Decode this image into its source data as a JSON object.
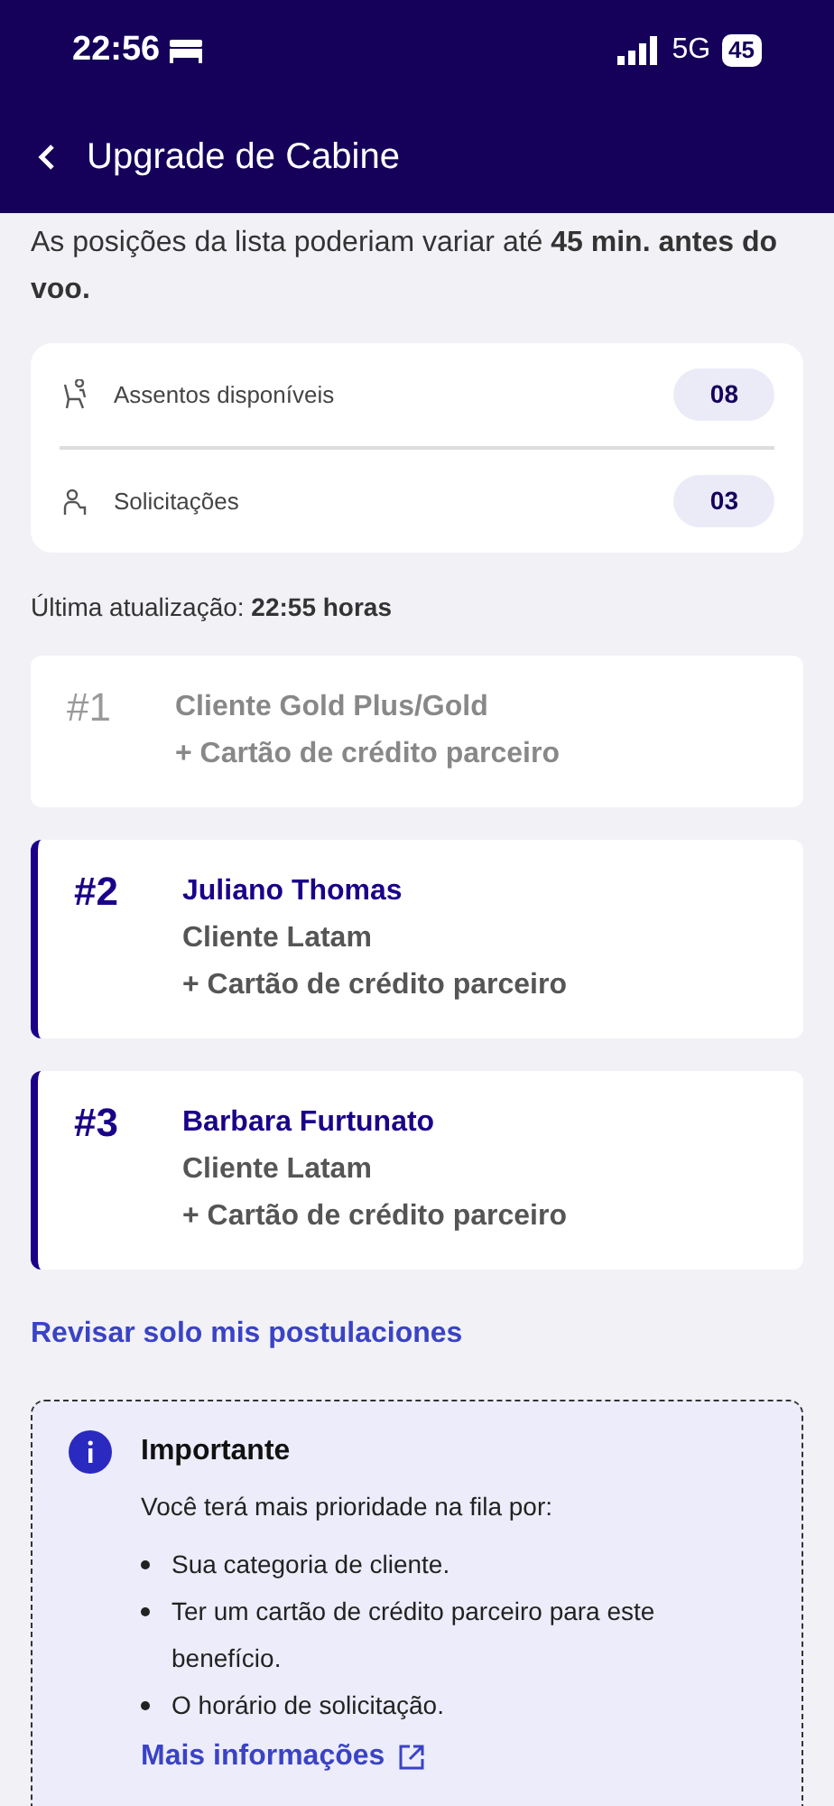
{
  "status_bar": {
    "time": "22:56",
    "network": "5G",
    "battery": "45"
  },
  "header": {
    "title": "Upgrade de Cabine"
  },
  "notice": "As posições da lista poderiam variar até **45 min. antes do voo.**",
  "summary": [
    {
      "kind": "seat",
      "label": "Assentos disponíveis",
      "count": "08"
    },
    {
      "kind": "person",
      "label": "Solicitações",
      "count": "03"
    }
  ],
  "last_update": "Última atualização: **22:55 horas**",
  "queue": [
    {
      "position": "#1",
      "highlighted": false,
      "lines": [
        "Cliente Gold Plus/Gold",
        "+ Cartão de crédito parceiro"
      ]
    },
    {
      "position": "#2",
      "highlighted": true,
      "name": "Juliano Thomas",
      "lines": [
        "Cliente Latam",
        "+ Cartão de crédito parceiro"
      ]
    },
    {
      "position": "#3",
      "highlighted": true,
      "name": "Barbara Furtunato",
      "lines": [
        "Cliente Latam",
        "+ Cartão de crédito parceiro"
      ]
    }
  ],
  "review_link": "Revisar solo mis postulaciones",
  "info": {
    "title": "Importante",
    "intro": "Você terá mais prioridade na fila por:",
    "bullets": [
      "Sua categoria de cliente.",
      "Ter um cartão de crédito parceiro para este benefício.",
      "O horário de solicitação."
    ],
    "link": "Mais informações"
  }
}
